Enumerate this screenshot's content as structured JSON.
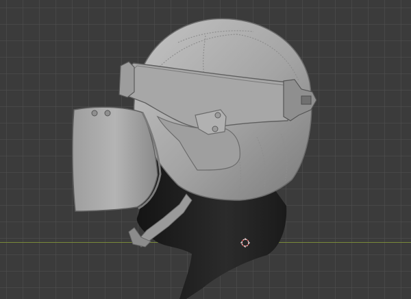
{
  "viewport": {
    "background_color": "#3b3b3b",
    "grid_color": "#505050",
    "x_axis_color": "#7a8a3a"
  },
  "model": {
    "helmet_color": "#a9a9a9",
    "head_color": "#1f1f1f"
  },
  "icons": {
    "cursor": "3d-cursor-icon"
  }
}
